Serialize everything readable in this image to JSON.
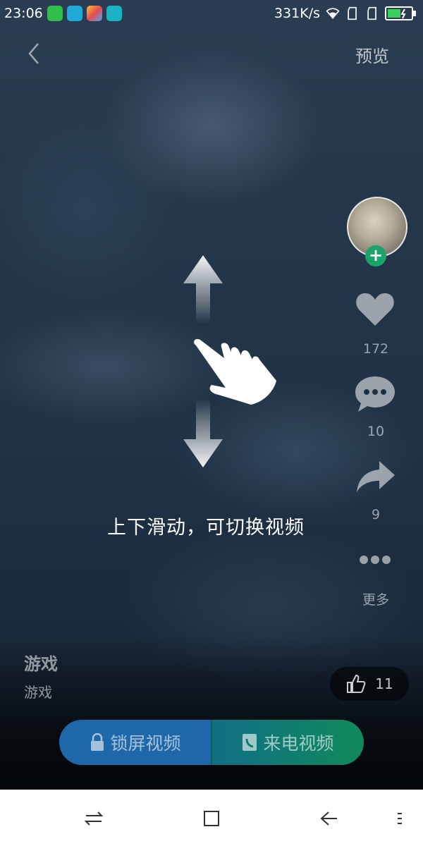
{
  "status_bar": {
    "time": "23:06",
    "net_speed": "331K/s"
  },
  "header": {
    "preview_label": "预览"
  },
  "hint": {
    "text": "上下滑动，可切换视频"
  },
  "actions": {
    "likes": "172",
    "comments": "10",
    "shares": "9",
    "more_label": "更多"
  },
  "video_info": {
    "title": "游戏",
    "subtitle": "游戏"
  },
  "thumb_count": "11",
  "buttons": {
    "lock_screen": "锁屏视频",
    "ringtone": "来电视频"
  },
  "colors": {
    "lock_button": "#1e67a8",
    "ringtone_button_end": "#0f8a5a",
    "follow": "#1aa36a"
  }
}
